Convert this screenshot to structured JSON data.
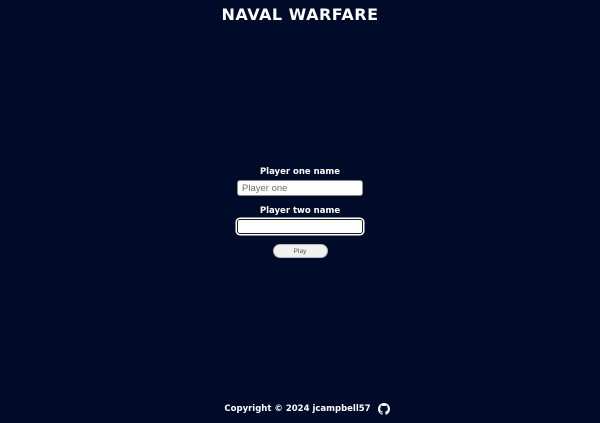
{
  "header": {
    "title": "NAVAL WARFARE"
  },
  "form": {
    "player_one_label": "Player one name",
    "player_one_placeholder": "Player one",
    "player_one_value": "",
    "player_two_label": "Player two name",
    "player_two_placeholder": "",
    "player_two_value": "",
    "play_label": "Play"
  },
  "footer": {
    "copyright": "Copyright © 2024 jcampbell57",
    "link_icon": "github-icon"
  },
  "colors": {
    "background": "#000b29",
    "text": "#ffffff",
    "button_bg": "#f0f0f0"
  }
}
